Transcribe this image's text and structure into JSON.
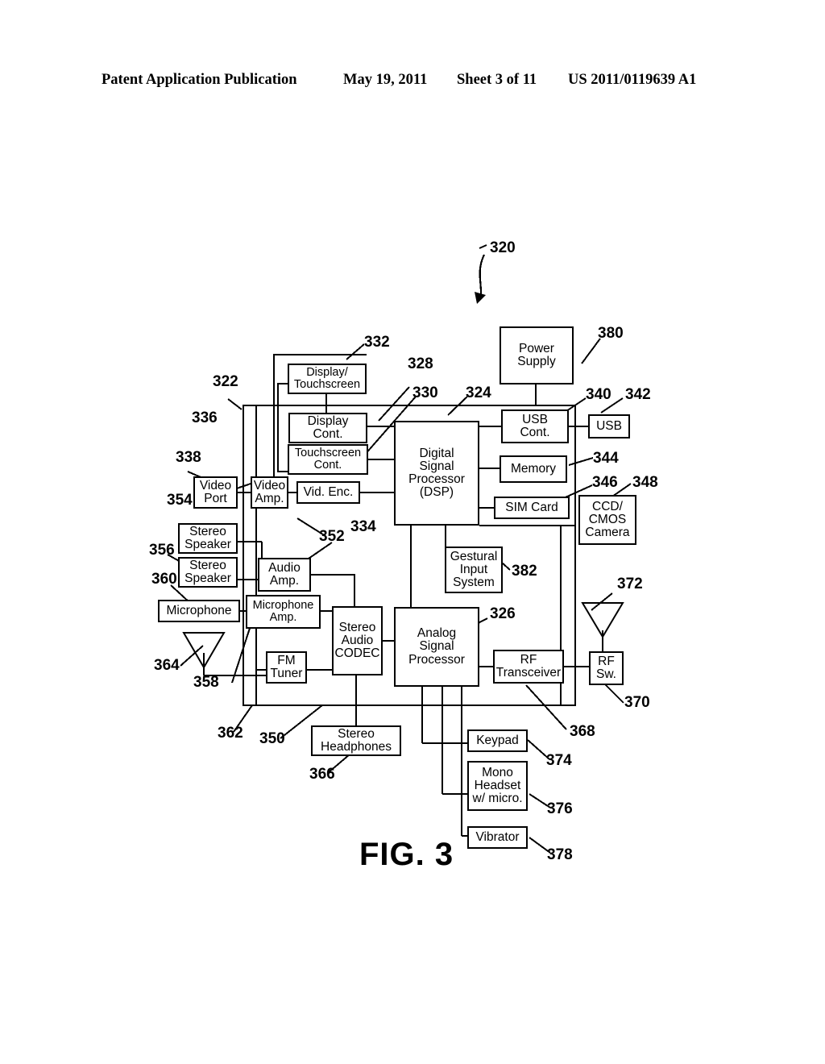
{
  "header": {
    "publication": "Patent Application Publication",
    "date": "May 19, 2011",
    "sheet": "Sheet 3 of 11",
    "number": "US 2011/0119639 A1"
  },
  "figure": {
    "caption": "FIG. 3",
    "system_numeral": "320"
  },
  "blocks": [
    {
      "id": "power_supply",
      "label": "Power\nSupply",
      "numeral": "380"
    },
    {
      "id": "display_touch",
      "label": "Display/\nTouchscreen",
      "numeral": "332"
    },
    {
      "id": "display_cont",
      "label": "Display\nCont.",
      "numeral": "328"
    },
    {
      "id": "touchscreen_cont",
      "label": "Touchscreen\nCont.",
      "numeral": "330"
    },
    {
      "id": "dsp",
      "label": "Digital\nSignal\nProcessor\n(DSP)",
      "numeral": "324"
    },
    {
      "id": "usb_cont",
      "label": "USB\nCont.",
      "numeral": "340"
    },
    {
      "id": "usb",
      "label": "USB",
      "numeral": "342"
    },
    {
      "id": "memory",
      "label": "Memory",
      "numeral": "344"
    },
    {
      "id": "sim_card",
      "label": "SIM Card",
      "numeral": "346"
    },
    {
      "id": "ccd_camera",
      "label": "CCD/\nCMOS\nCamera",
      "numeral": "348"
    },
    {
      "id": "video_port",
      "label": "Video\nPort",
      "numeral": "338"
    },
    {
      "id": "video_amp",
      "label": "Video\nAmp.",
      "numeral": "336"
    },
    {
      "id": "vid_enc",
      "label": "Vid. Enc.",
      "numeral": "334"
    },
    {
      "id": "stereo_speaker_1",
      "label": "Stereo\nSpeaker",
      "numeral": "354"
    },
    {
      "id": "stereo_speaker_2",
      "label": "Stereo\nSpeaker",
      "numeral": "356"
    },
    {
      "id": "microphone",
      "label": "Microphone",
      "numeral": "360"
    },
    {
      "id": "audio_amp",
      "label": "Audio\nAmp.",
      "numeral": "352"
    },
    {
      "id": "microphone_amp",
      "label": "Microphone\nAmp.",
      "numeral": "358"
    },
    {
      "id": "fm_tuner",
      "label": "FM\nTuner",
      "numeral": "362"
    },
    {
      "id": "stereo_codec",
      "label": "Stereo\nAudio\nCODEC",
      "numeral": "350"
    },
    {
      "id": "analog_proc",
      "label": "Analog\nSignal\nProcessor",
      "numeral": "326"
    },
    {
      "id": "gestural_input",
      "label": "Gestural\nInput\nSystem",
      "numeral": "382"
    },
    {
      "id": "rf_transceiver",
      "label": "RF\nTransceiver",
      "numeral": "368"
    },
    {
      "id": "rf_sw",
      "label": "RF\nSw.",
      "numeral": "370"
    },
    {
      "id": "stereo_headphones",
      "label": "Stereo\nHeadphones",
      "numeral": "366"
    },
    {
      "id": "keypad",
      "label": "Keypad",
      "numeral": "374"
    },
    {
      "id": "mono_headset",
      "label": "Mono\nHeadset\nw/ micro.",
      "numeral": "376"
    },
    {
      "id": "vibrator",
      "label": "Vibrator",
      "numeral": "378"
    }
  ],
  "antennas": [
    {
      "id": "fm_antenna",
      "numeral": "364"
    },
    {
      "id": "rf_antenna",
      "numeral": "372"
    }
  ],
  "system_boundary": {
    "numeral": "322"
  },
  "numerals": {
    "n320": "320",
    "n322": "322",
    "n324": "324",
    "n326": "326",
    "n328": "328",
    "n330": "330",
    "n332": "332",
    "n334": "334",
    "n336": "336",
    "n338": "338",
    "n340": "340",
    "n342": "342",
    "n344": "344",
    "n346": "346",
    "n348": "348",
    "n350": "350",
    "n352": "352",
    "n354": "354",
    "n356": "356",
    "n358": "358",
    "n360": "360",
    "n362": "362",
    "n364": "364",
    "n366": "366",
    "n368": "368",
    "n370": "370",
    "n372": "372",
    "n374": "374",
    "n376": "376",
    "n378": "378",
    "n380": "380",
    "n382": "382"
  },
  "colors": {
    "ink": "#000000",
    "paper": "#ffffff"
  }
}
